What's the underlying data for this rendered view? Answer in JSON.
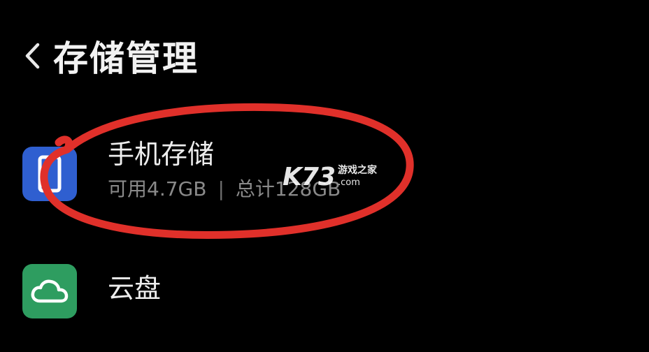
{
  "header": {
    "title": "存储管理",
    "back_icon": "chevron-left-icon"
  },
  "items": [
    {
      "title": "手机存储",
      "available": "可用4.7GB",
      "separator": "|",
      "total": "总计128GB",
      "icon": "phone-icon",
      "icon_color": "#2f5fd0"
    },
    {
      "title": "云盘",
      "icon": "cloud-icon",
      "icon_color": "#2e9d60"
    }
  ],
  "watermark": {
    "logo": "K73",
    "name": "游戏之家",
    "domain": ".com"
  },
  "colors": {
    "background": "#000000",
    "annotation": "#e0302a"
  }
}
